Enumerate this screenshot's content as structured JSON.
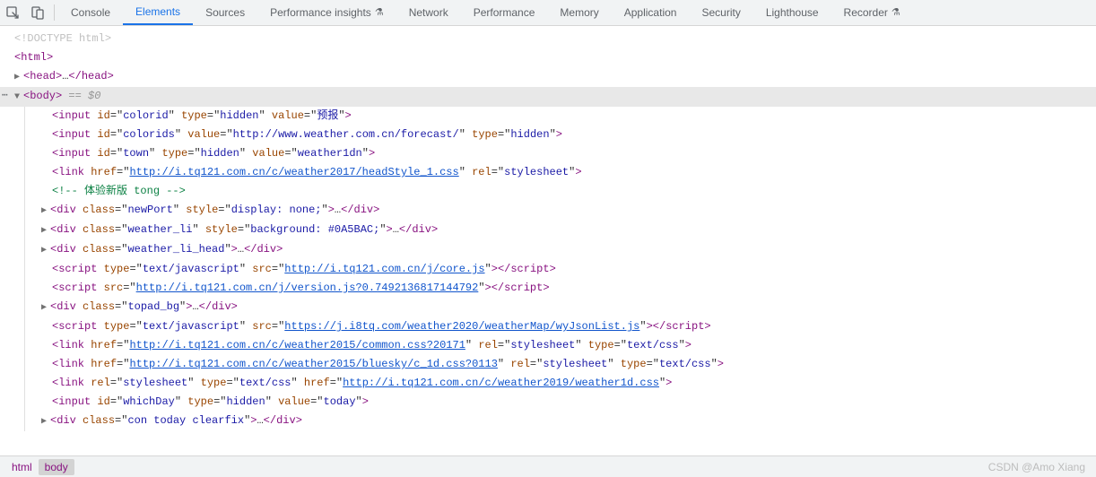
{
  "tabs": {
    "console": "Console",
    "elements": "Elements",
    "sources": "Sources",
    "perf_insights": "Performance insights",
    "network": "Network",
    "performance": "Performance",
    "memory": "Memory",
    "application": "Application",
    "security": "Security",
    "lighthouse": "Lighthouse",
    "recorder": "Recorder"
  },
  "tree": {
    "doctype": "<!DOCTYPE html>",
    "html_open": "html",
    "head_open": "head",
    "body_open": "body",
    "body_eq": " == $0",
    "tag_input": "input",
    "tag_link": "link",
    "tag_div": "div",
    "tag_script": "script",
    "attr_id": "id",
    "attr_type": "type",
    "attr_value": "value",
    "attr_href": "href",
    "attr_rel": "rel",
    "attr_src": "src",
    "attr_class": "class",
    "attr_style": "style",
    "val_colorid": "colorid",
    "val_hidden": "hidden",
    "val_yubao": "预报",
    "val_colorids": "colorids",
    "val_forecast_url": "http://www.weather.com.cn/forecast/",
    "val_town": "town",
    "val_weather1dn": "weather1dn",
    "val_headstyle": "http://i.tq121.com.cn/c/weather2017/headStyle_1.css",
    "val_stylesheet": "stylesheet",
    "comment_text": " 体验新版 tong ",
    "val_newPort": "newPort",
    "val_display_none": "display: none;",
    "val_weather_li": "weather_li",
    "val_bg_color": "background: #0A5BAC;",
    "val_weather_li_head": "weather_li_head",
    "val_text_js": "text/javascript",
    "val_core_js": "http://i.tq121.com.cn/j/core.js",
    "val_version_js": "http://i.tq121.com.cn/j/version.js?0.7492136817144792",
    "val_topad_bg": "topad_bg",
    "val_wyjson": "https://j.i8tq.com/weather2020/weatherMap/wyJsonList.js",
    "val_common_css": "http://i.tq121.com.cn/c/weather2015/common.css?20171",
    "val_text_css": "text/css",
    "val_bluesky": "http://i.tq121.com.cn/c/weather2015/bluesky/c_1d.css?0113",
    "val_weather1d": "http://i.tq121.com.cn/c/weather2019/weather1d.css",
    "val_whichDay": "whichDay",
    "val_today": "today",
    "val_con_today": "con today clearfix"
  },
  "breadcrumb": {
    "html": "html",
    "body": "body"
  },
  "watermark": "CSDN @Amo Xiang"
}
